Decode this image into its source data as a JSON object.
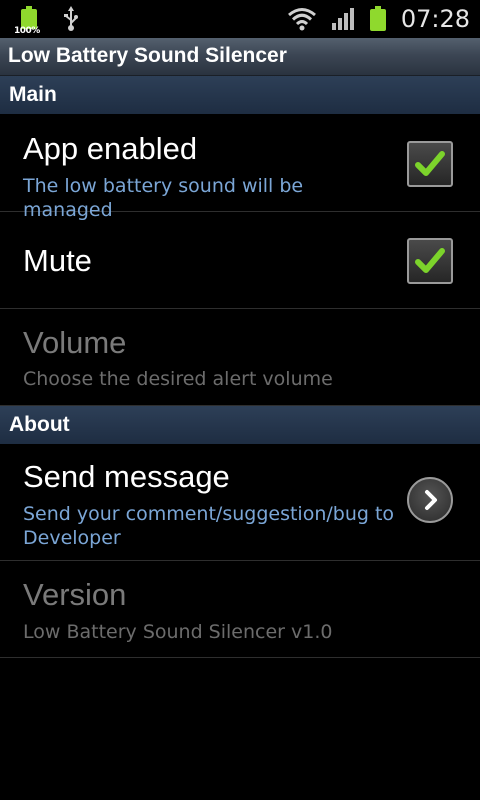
{
  "status_bar": {
    "battery_percent_label": "100%",
    "time": "07:28"
  },
  "title_bar": {
    "title": "Low Battery Sound Silencer"
  },
  "categories": [
    {
      "label": "Main"
    },
    {
      "label": "About"
    }
  ],
  "prefs": {
    "app_enabled": {
      "title": "App enabled",
      "summary": "The low battery sound will be managed",
      "checked": true
    },
    "mute": {
      "title": "Mute",
      "checked": true
    },
    "volume": {
      "title": "Volume",
      "summary": "Choose the desired alert volume",
      "enabled": false
    },
    "send_message": {
      "title": "Send message",
      "summary": "Send your comment/suggestion/bug to Developer"
    },
    "version": {
      "title": "Version",
      "summary": "Low Battery Sound Silencer v1.0",
      "enabled": false
    }
  },
  "colors": {
    "background": "#000000",
    "summary_text": "#7ba6d6",
    "disabled_text": "#7a7a7a",
    "check_mark": "#7cd32b",
    "battery_green": "#8fd92d"
  },
  "icons": {
    "battery_notification": "battery-full-icon",
    "usb": "usb-icon",
    "wifi": "wifi-icon",
    "signal": "signal-bars-icon",
    "battery_status": "battery-icon",
    "check": "check-mark-icon",
    "chevron": "chevron-right-icon"
  }
}
